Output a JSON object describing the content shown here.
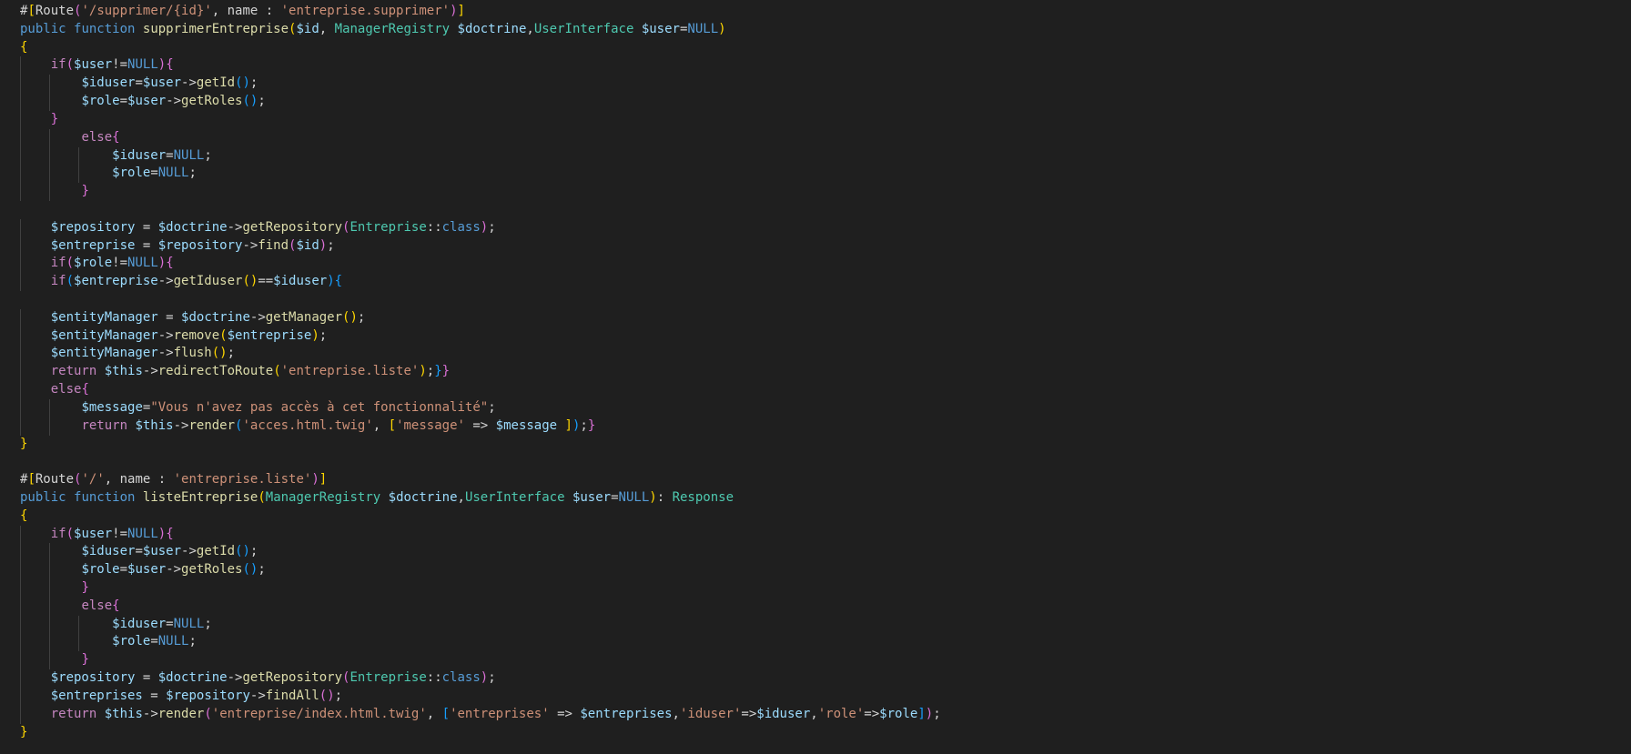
{
  "editor": {
    "language": "php",
    "theme_colors": {
      "background": "#1f1f1f",
      "keyword": "#569cd6",
      "control": "#c586c0",
      "variable": "#9cdcfe",
      "function": "#dcdcaa",
      "string": "#ce9178",
      "type": "#4ec9b0",
      "text": "#d4d4d4",
      "bracket_level1": "#ffd700",
      "bracket_level2": "#da70d6",
      "bracket_level3": "#179fff"
    },
    "lines": [
      {
        "indent": 0,
        "tokens": [
          [
            "plain",
            "#"
          ],
          [
            "b1",
            "["
          ],
          [
            "plain",
            "Route"
          ],
          [
            "b2",
            "("
          ],
          [
            "str",
            "'/supprimer/{id}'"
          ],
          [
            "plain",
            ", name : "
          ],
          [
            "str",
            "'entreprise.supprimer'"
          ],
          [
            "b2",
            ")"
          ],
          [
            "b1",
            "]"
          ]
        ]
      },
      {
        "indent": 0,
        "tokens": [
          [
            "kw",
            "public"
          ],
          [
            "plain",
            " "
          ],
          [
            "kw",
            "function"
          ],
          [
            "plain",
            " "
          ],
          [
            "fn",
            "supprimerEntreprise"
          ],
          [
            "b1",
            "("
          ],
          [
            "var",
            "$id"
          ],
          [
            "plain",
            ", "
          ],
          [
            "type",
            "ManagerRegistry"
          ],
          [
            "plain",
            " "
          ],
          [
            "var",
            "$doctrine"
          ],
          [
            "plain",
            ","
          ],
          [
            "type",
            "UserInterface"
          ],
          [
            "plain",
            " "
          ],
          [
            "var",
            "$user"
          ],
          [
            "plain",
            "="
          ],
          [
            "kw",
            "NULL"
          ],
          [
            "b1",
            ")"
          ]
        ]
      },
      {
        "indent": 0,
        "tokens": [
          [
            "b1",
            "{"
          ]
        ]
      },
      {
        "indent": 1,
        "tokens": [
          [
            "ctl",
            "if"
          ],
          [
            "b2",
            "("
          ],
          [
            "var",
            "$user"
          ],
          [
            "plain",
            "!="
          ],
          [
            "kw",
            "NULL"
          ],
          [
            "b2",
            ")"
          ],
          [
            "b2",
            "{"
          ]
        ]
      },
      {
        "indent": 2,
        "tokens": [
          [
            "var",
            "$iduser"
          ],
          [
            "plain",
            "="
          ],
          [
            "var",
            "$user"
          ],
          [
            "plain",
            "->"
          ],
          [
            "fn",
            "getId"
          ],
          [
            "b3",
            "()"
          ],
          [
            "plain",
            ";"
          ]
        ]
      },
      {
        "indent": 2,
        "tokens": [
          [
            "var",
            "$role"
          ],
          [
            "plain",
            "="
          ],
          [
            "var",
            "$user"
          ],
          [
            "plain",
            "->"
          ],
          [
            "fn",
            "getRoles"
          ],
          [
            "b3",
            "()"
          ],
          [
            "plain",
            ";"
          ]
        ]
      },
      {
        "indent": 1,
        "tokens": [
          [
            "b2",
            "}"
          ]
        ]
      },
      {
        "indent": 2,
        "tokens": [
          [
            "ctl",
            "else"
          ],
          [
            "b2",
            "{"
          ]
        ]
      },
      {
        "indent": 3,
        "tokens": [
          [
            "var",
            "$iduser"
          ],
          [
            "plain",
            "="
          ],
          [
            "kw",
            "NULL"
          ],
          [
            "plain",
            ";"
          ]
        ]
      },
      {
        "indent": 3,
        "tokens": [
          [
            "var",
            "$role"
          ],
          [
            "plain",
            "="
          ],
          [
            "kw",
            "NULL"
          ],
          [
            "plain",
            ";"
          ]
        ]
      },
      {
        "indent": 2,
        "tokens": [
          [
            "b2",
            "}"
          ]
        ]
      },
      {
        "indent": 0,
        "tokens": []
      },
      {
        "indent": 1,
        "tokens": [
          [
            "var",
            "$repository"
          ],
          [
            "plain",
            " = "
          ],
          [
            "var",
            "$doctrine"
          ],
          [
            "plain",
            "->"
          ],
          [
            "fn",
            "getRepository"
          ],
          [
            "b2",
            "("
          ],
          [
            "type",
            "Entreprise"
          ],
          [
            "plain",
            "::"
          ],
          [
            "kw",
            "class"
          ],
          [
            "b2",
            ")"
          ],
          [
            "plain",
            ";"
          ]
        ]
      },
      {
        "indent": 1,
        "tokens": [
          [
            "var",
            "$entreprise"
          ],
          [
            "plain",
            " = "
          ],
          [
            "var",
            "$repository"
          ],
          [
            "plain",
            "->"
          ],
          [
            "fn",
            "find"
          ],
          [
            "b2",
            "("
          ],
          [
            "var",
            "$id"
          ],
          [
            "b2",
            ")"
          ],
          [
            "plain",
            ";"
          ]
        ]
      },
      {
        "indent": 1,
        "tokens": [
          [
            "ctl",
            "if"
          ],
          [
            "b2",
            "("
          ],
          [
            "var",
            "$role"
          ],
          [
            "plain",
            "!="
          ],
          [
            "kw",
            "NULL"
          ],
          [
            "b2",
            ")"
          ],
          [
            "b2",
            "{"
          ]
        ]
      },
      {
        "indent": 1,
        "tokens": [
          [
            "ctl",
            "if"
          ],
          [
            "b3",
            "("
          ],
          [
            "var",
            "$entreprise"
          ],
          [
            "plain",
            "->"
          ],
          [
            "fn",
            "getIduser"
          ],
          [
            "b1",
            "()"
          ],
          [
            "plain",
            "=="
          ],
          [
            "var",
            "$iduser"
          ],
          [
            "b3",
            ")"
          ],
          [
            "b3",
            "{"
          ]
        ]
      },
      {
        "indent": 0,
        "tokens": []
      },
      {
        "indent": 1,
        "tokens": [
          [
            "var",
            "$entityManager"
          ],
          [
            "plain",
            " = "
          ],
          [
            "var",
            "$doctrine"
          ],
          [
            "plain",
            "->"
          ],
          [
            "fn",
            "getManager"
          ],
          [
            "b1",
            "()"
          ],
          [
            "plain",
            ";"
          ]
        ]
      },
      {
        "indent": 1,
        "tokens": [
          [
            "var",
            "$entityManager"
          ],
          [
            "plain",
            "->"
          ],
          [
            "fn",
            "remove"
          ],
          [
            "b1",
            "("
          ],
          [
            "var",
            "$entreprise"
          ],
          [
            "b1",
            ")"
          ],
          [
            "plain",
            ";"
          ]
        ]
      },
      {
        "indent": 1,
        "tokens": [
          [
            "var",
            "$entityManager"
          ],
          [
            "plain",
            "->"
          ],
          [
            "fn",
            "flush"
          ],
          [
            "b1",
            "()"
          ],
          [
            "plain",
            ";"
          ]
        ]
      },
      {
        "indent": 1,
        "tokens": [
          [
            "ctl",
            "return"
          ],
          [
            "plain",
            " "
          ],
          [
            "var",
            "$this"
          ],
          [
            "plain",
            "->"
          ],
          [
            "fn",
            "redirectToRoute"
          ],
          [
            "b1",
            "("
          ],
          [
            "str",
            "'entreprise.liste'"
          ],
          [
            "b1",
            ")"
          ],
          [
            "plain",
            ";"
          ],
          [
            "b3",
            "}"
          ],
          [
            "b2",
            "}"
          ]
        ]
      },
      {
        "indent": 1,
        "tokens": [
          [
            "ctl",
            "else"
          ],
          [
            "b2",
            "{"
          ]
        ]
      },
      {
        "indent": 2,
        "tokens": [
          [
            "var",
            "$message"
          ],
          [
            "plain",
            "="
          ],
          [
            "str",
            "\"Vous n'avez pas accès à cet fonctionnalité\""
          ],
          [
            "plain",
            ";"
          ]
        ]
      },
      {
        "indent": 2,
        "tokens": [
          [
            "ctl",
            "return"
          ],
          [
            "plain",
            " "
          ],
          [
            "var",
            "$this"
          ],
          [
            "plain",
            "->"
          ],
          [
            "fn",
            "render"
          ],
          [
            "b3",
            "("
          ],
          [
            "str",
            "'acces.html.twig'"
          ],
          [
            "plain",
            ", "
          ],
          [
            "b1",
            "["
          ],
          [
            "str",
            "'message'"
          ],
          [
            "plain",
            " => "
          ],
          [
            "var",
            "$message"
          ],
          [
            "plain",
            " "
          ],
          [
            "b1",
            "]"
          ],
          [
            "b3",
            ")"
          ],
          [
            "plain",
            ";"
          ],
          [
            "b2",
            "}"
          ]
        ]
      },
      {
        "indent": 0,
        "tokens": [
          [
            "b1",
            "}"
          ]
        ]
      },
      {
        "indent": 0,
        "tokens": []
      },
      {
        "indent": 0,
        "tokens": [
          [
            "plain",
            "#"
          ],
          [
            "b1",
            "["
          ],
          [
            "plain",
            "Route"
          ],
          [
            "b2",
            "("
          ],
          [
            "str",
            "'/'"
          ],
          [
            "plain",
            ", name : "
          ],
          [
            "str",
            "'entreprise.liste'"
          ],
          [
            "b2",
            ")"
          ],
          [
            "b1",
            "]"
          ]
        ]
      },
      {
        "indent": 0,
        "tokens": [
          [
            "kw",
            "public"
          ],
          [
            "plain",
            " "
          ],
          [
            "kw",
            "function"
          ],
          [
            "plain",
            " "
          ],
          [
            "fn",
            "listeEntreprise"
          ],
          [
            "b1",
            "("
          ],
          [
            "type",
            "ManagerRegistry"
          ],
          [
            "plain",
            " "
          ],
          [
            "var",
            "$doctrine"
          ],
          [
            "plain",
            ","
          ],
          [
            "type",
            "UserInterface"
          ],
          [
            "plain",
            " "
          ],
          [
            "var",
            "$user"
          ],
          [
            "plain",
            "="
          ],
          [
            "kw",
            "NULL"
          ],
          [
            "b1",
            ")"
          ],
          [
            "plain",
            ": "
          ],
          [
            "type",
            "Response"
          ]
        ]
      },
      {
        "indent": 0,
        "tokens": [
          [
            "b1",
            "{"
          ]
        ]
      },
      {
        "indent": 1,
        "tokens": [
          [
            "ctl",
            "if"
          ],
          [
            "b2",
            "("
          ],
          [
            "var",
            "$user"
          ],
          [
            "plain",
            "!="
          ],
          [
            "kw",
            "NULL"
          ],
          [
            "b2",
            ")"
          ],
          [
            "b2",
            "{"
          ]
        ]
      },
      {
        "indent": 2,
        "tokens": [
          [
            "var",
            "$iduser"
          ],
          [
            "plain",
            "="
          ],
          [
            "var",
            "$user"
          ],
          [
            "plain",
            "->"
          ],
          [
            "fn",
            "getId"
          ],
          [
            "b3",
            "()"
          ],
          [
            "plain",
            ";"
          ]
        ]
      },
      {
        "indent": 2,
        "tokens": [
          [
            "var",
            "$role"
          ],
          [
            "plain",
            "="
          ],
          [
            "var",
            "$user"
          ],
          [
            "plain",
            "->"
          ],
          [
            "fn",
            "getRoles"
          ],
          [
            "b3",
            "()"
          ],
          [
            "plain",
            ";"
          ]
        ]
      },
      {
        "indent": 2,
        "tokens": [
          [
            "b2",
            "}"
          ]
        ]
      },
      {
        "indent": 2,
        "tokens": [
          [
            "ctl",
            "else"
          ],
          [
            "b2",
            "{"
          ]
        ]
      },
      {
        "indent": 3,
        "tokens": [
          [
            "var",
            "$iduser"
          ],
          [
            "plain",
            "="
          ],
          [
            "kw",
            "NULL"
          ],
          [
            "plain",
            ";"
          ]
        ]
      },
      {
        "indent": 3,
        "tokens": [
          [
            "var",
            "$role"
          ],
          [
            "plain",
            "="
          ],
          [
            "kw",
            "NULL"
          ],
          [
            "plain",
            ";"
          ]
        ]
      },
      {
        "indent": 2,
        "tokens": [
          [
            "b2",
            "}"
          ]
        ]
      },
      {
        "indent": 1,
        "tokens": [
          [
            "var",
            "$repository"
          ],
          [
            "plain",
            " = "
          ],
          [
            "var",
            "$doctrine"
          ],
          [
            "plain",
            "->"
          ],
          [
            "fn",
            "getRepository"
          ],
          [
            "b2",
            "("
          ],
          [
            "type",
            "Entreprise"
          ],
          [
            "plain",
            "::"
          ],
          [
            "kw",
            "class"
          ],
          [
            "b2",
            ")"
          ],
          [
            "plain",
            ";"
          ]
        ]
      },
      {
        "indent": 1,
        "tokens": [
          [
            "var",
            "$entreprises"
          ],
          [
            "plain",
            " = "
          ],
          [
            "var",
            "$repository"
          ],
          [
            "plain",
            "->"
          ],
          [
            "fn",
            "findAll"
          ],
          [
            "b2",
            "()"
          ],
          [
            "plain",
            ";"
          ]
        ]
      },
      {
        "indent": 1,
        "tokens": [
          [
            "ctl",
            "return"
          ],
          [
            "plain",
            " "
          ],
          [
            "var",
            "$this"
          ],
          [
            "plain",
            "->"
          ],
          [
            "fn",
            "render"
          ],
          [
            "b2",
            "("
          ],
          [
            "str",
            "'entreprise/index.html.twig'"
          ],
          [
            "plain",
            ", "
          ],
          [
            "b3",
            "["
          ],
          [
            "str",
            "'entreprises'"
          ],
          [
            "plain",
            " => "
          ],
          [
            "var",
            "$entreprises"
          ],
          [
            "plain",
            ","
          ],
          [
            "str",
            "'iduser'"
          ],
          [
            "plain",
            "=>"
          ],
          [
            "var",
            "$iduser"
          ],
          [
            "plain",
            ","
          ],
          [
            "str",
            "'role'"
          ],
          [
            "plain",
            "=>"
          ],
          [
            "var",
            "$role"
          ],
          [
            "b3",
            "]"
          ],
          [
            "b2",
            ")"
          ],
          [
            "plain",
            ";"
          ]
        ]
      },
      {
        "indent": 0,
        "tokens": [
          [
            "b1",
            "}"
          ]
        ]
      }
    ]
  }
}
